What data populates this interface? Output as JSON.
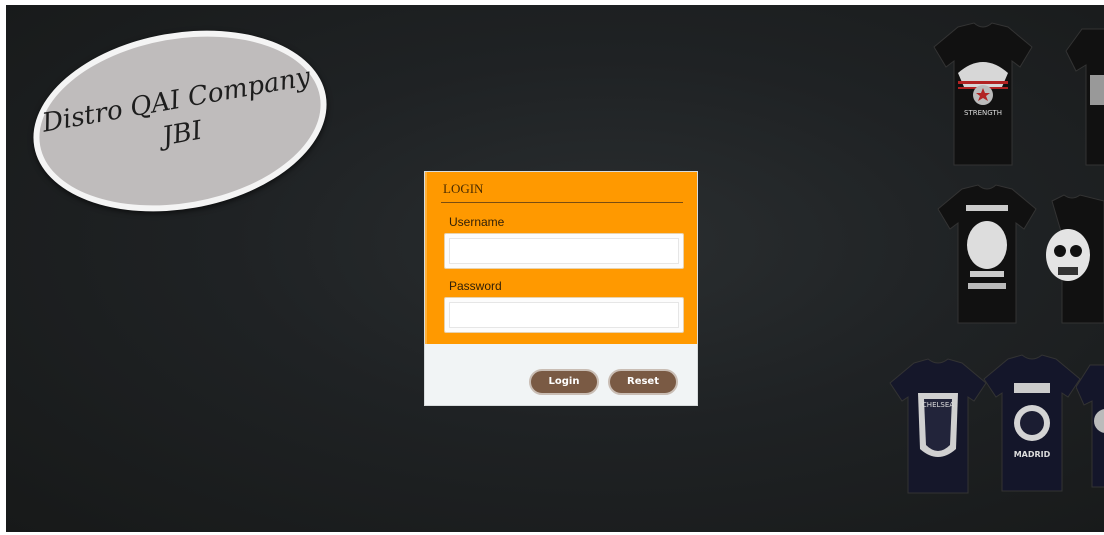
{
  "logo": {
    "line1": "Distro QAI Company",
    "line2": "JBI"
  },
  "login": {
    "title": "LOGIN",
    "username_label": "Username",
    "username_value": "",
    "password_label": "Password",
    "password_value": "",
    "login_button": "Login",
    "reset_button": "Reset"
  },
  "gallery": {
    "shirts": [
      {
        "name": "eagle-strength-shirt",
        "print": "STRENGTH"
      },
      {
        "name": "skull-shirt",
        "print": ""
      },
      {
        "name": "chelsea-shirt",
        "print": "CHELSEA"
      },
      {
        "name": "madrid-shirt",
        "print": "MADRID"
      }
    ]
  },
  "colors": {
    "accent": "#ff9900",
    "button": "#7a5a44",
    "background": "#1f2224"
  }
}
